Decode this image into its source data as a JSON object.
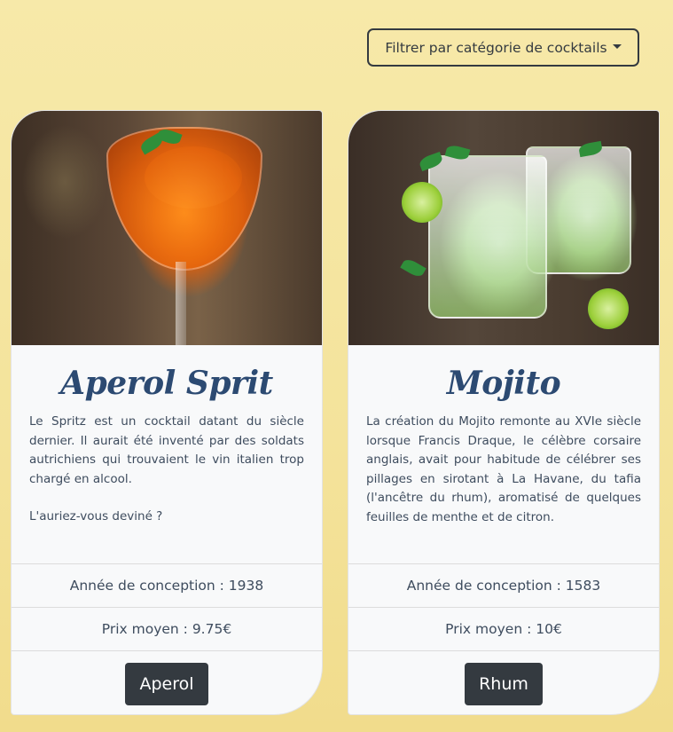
{
  "filter": {
    "label": "Filtrer par catégorie de cocktails"
  },
  "cards": [
    {
      "title": "Aperol Sprit",
      "image": "aperol-spritz-photo",
      "description_paragraphs": [
        "Le Spritz est un cocktail datant du siècle dernier. Il aurait été inventé par des soldats autrichiens qui trouvaient le vin italien trop chargé en alcool.",
        "L'auriez-vous deviné ?"
      ],
      "year_text": "Année de conception : 1938",
      "price_text": "Prix moyen : 9.75€",
      "category_button": "Aperol"
    },
    {
      "title": "Mojito",
      "image": "mojito-photo",
      "description_paragraphs": [
        "La création du Mojito remonte au XVIe siècle lorsque Francis Draque, le célèbre corsaire anglais, avait pour habitude de célébrer ses pillages en sirotant à La Havane, du tafia (l'ancêtre du rhum), aromatisé de quelques feuilles de menthe et de citron."
      ],
      "year_text": "Année de conception : 1583",
      "price_text": "Prix moyen : 10€",
      "category_button": "Rhum"
    }
  ],
  "colors": {
    "background": "#f5e6a3",
    "title": "#2c4a72",
    "button_dark": "#343a40",
    "card_bg": "#f8f9fa"
  }
}
